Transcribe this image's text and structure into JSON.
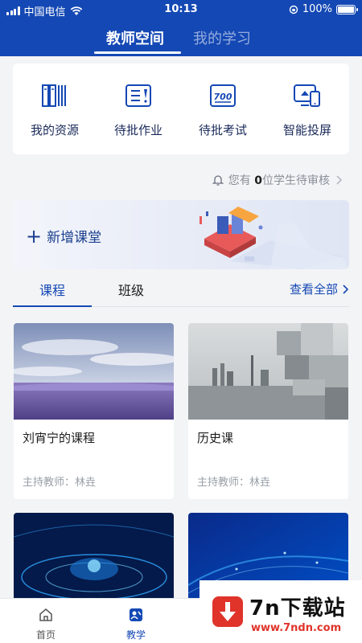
{
  "status_bar": {
    "carrier": "中国电信",
    "time": "10:13",
    "battery": "100%"
  },
  "top_tabs": [
    {
      "label": "教师空间",
      "active": true
    },
    {
      "label": "我的学习",
      "active": false
    }
  ],
  "quick_actions": [
    {
      "label": "我的资源",
      "icon": "books-icon"
    },
    {
      "label": "待批作业",
      "icon": "homework-icon"
    },
    {
      "label": "待批考试",
      "icon": "exam-icon"
    },
    {
      "label": "智能投屏",
      "icon": "screen-cast-icon"
    }
  ],
  "notice": {
    "prefix": "您有",
    "count": "0",
    "suffix": "位学生待审核"
  },
  "banner": {
    "label": "新增课堂"
  },
  "section_tabs": {
    "course": "课程",
    "class": "班级",
    "view_all": "查看全部"
  },
  "courses": [
    {
      "title": "刘宵宁的课程",
      "teacher": "主持教师：林垚"
    },
    {
      "title": "历史课",
      "teacher": "主持教师：林垚"
    }
  ],
  "bottom_nav": {
    "home": "首页",
    "teach": "教学"
  },
  "watermark": {
    "title": "7n下载站",
    "url": "www.7ndn.com"
  },
  "colors": {
    "primary": "#1448b4",
    "background": "#f3f4f6"
  }
}
